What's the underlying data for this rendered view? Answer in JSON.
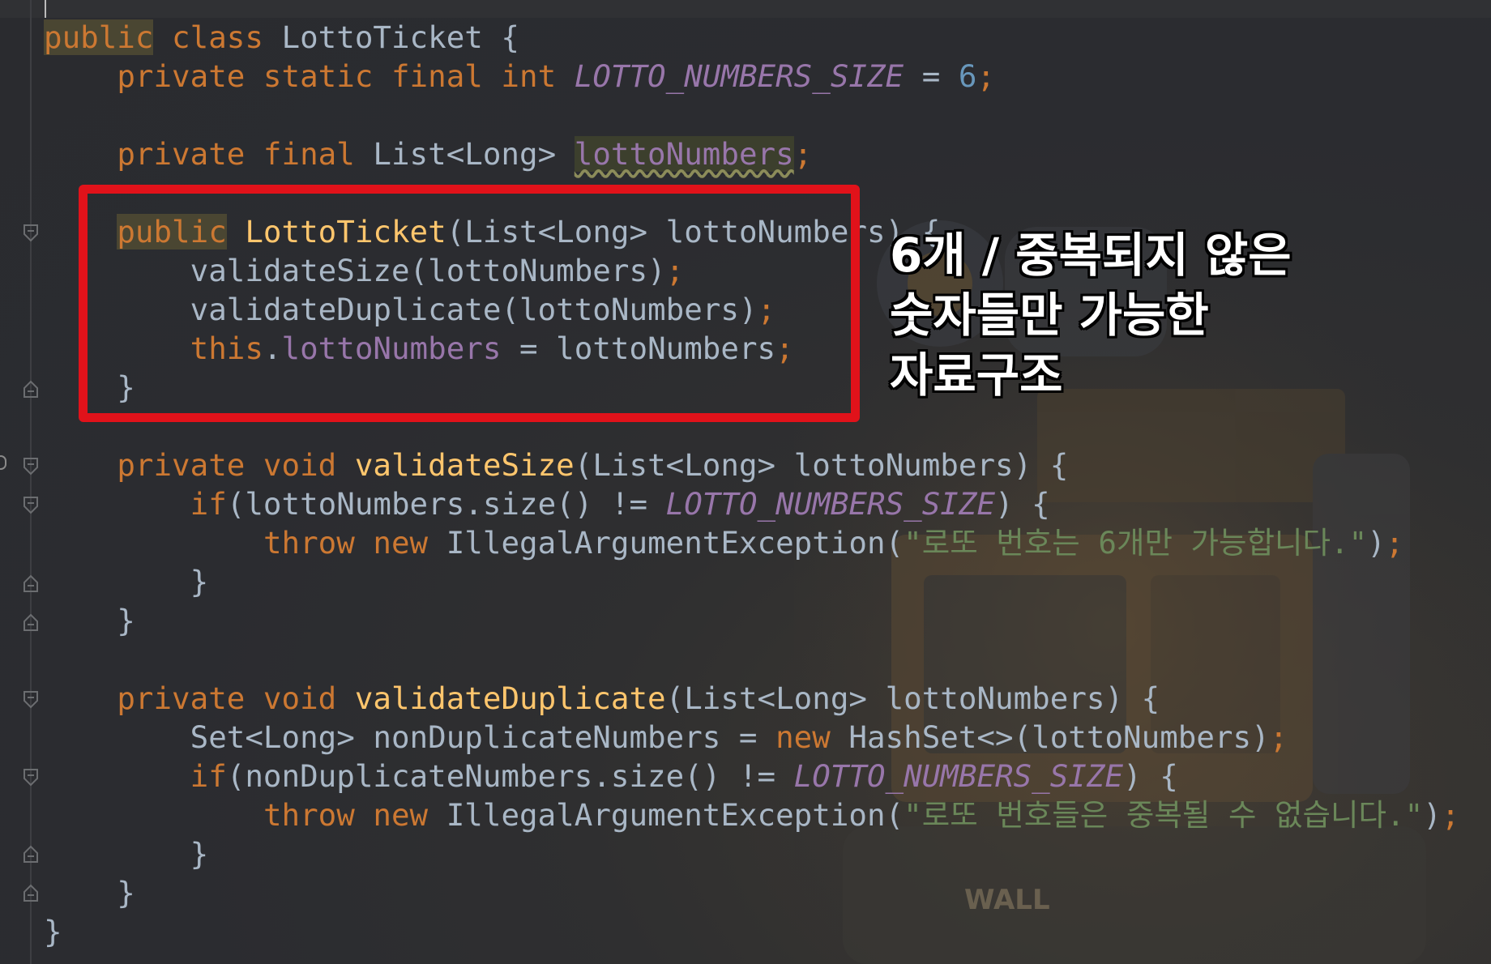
{
  "editor": {
    "lines": [
      [
        {
          "t": "public",
          "c": "kw hl"
        },
        {
          "t": " "
        },
        {
          "t": "class",
          "c": "kw"
        },
        {
          "t": " LottoTicket {"
        }
      ],
      [
        {
          "t": "    "
        },
        {
          "t": "private static final int",
          "c": "kw"
        },
        {
          "t": " "
        },
        {
          "t": "LOTTO_NUMBERS_SIZE",
          "c": "cst"
        },
        {
          "t": " = "
        },
        {
          "t": "6",
          "c": "num"
        },
        {
          "t": ";",
          "c": "kw"
        }
      ],
      [],
      [
        {
          "t": "    "
        },
        {
          "t": "private final",
          "c": "kw"
        },
        {
          "t": " List<Long> "
        },
        {
          "t": "lottoNumbers",
          "c": "fld warn"
        },
        {
          "t": ";",
          "c": "kw"
        }
      ],
      [],
      [
        {
          "t": "    "
        },
        {
          "t": "public",
          "c": "kw hl"
        },
        {
          "t": " "
        },
        {
          "t": "LottoTicket",
          "c": "fn"
        },
        {
          "t": "(List<Long> lottoNumbers) {"
        }
      ],
      [
        {
          "t": "        validateSize(lottoNumbers)"
        },
        {
          "t": ";",
          "c": "kw"
        }
      ],
      [
        {
          "t": "        validateDuplicate(lottoNumbers)"
        },
        {
          "t": ";",
          "c": "kw"
        }
      ],
      [
        {
          "t": "        "
        },
        {
          "t": "this",
          "c": "kw"
        },
        {
          "t": "."
        },
        {
          "t": "lottoNumbers",
          "c": "fld"
        },
        {
          "t": " = lottoNumbers"
        },
        {
          "t": ";",
          "c": "kw"
        }
      ],
      [
        {
          "t": "    }"
        }
      ],
      [],
      [
        {
          "t": "    "
        },
        {
          "t": "private void",
          "c": "kw"
        },
        {
          "t": " "
        },
        {
          "t": "validateSize",
          "c": "fn"
        },
        {
          "t": "(List<Long> lottoNumbers) {"
        }
      ],
      [
        {
          "t": "        "
        },
        {
          "t": "if",
          "c": "kw"
        },
        {
          "t": "(lottoNumbers.size() != "
        },
        {
          "t": "LOTTO_NUMBERS_SIZE",
          "c": "cst"
        },
        {
          "t": ") {"
        }
      ],
      [
        {
          "t": "            "
        },
        {
          "t": "throw new",
          "c": "kw"
        },
        {
          "t": " IllegalArgumentException("
        },
        {
          "t": "\"로또 번호는 6개만 가능합니다.\"",
          "c": "str"
        },
        {
          "t": ")"
        },
        {
          "t": ";",
          "c": "kw"
        }
      ],
      [
        {
          "t": "        }"
        }
      ],
      [
        {
          "t": "    }"
        }
      ],
      [],
      [
        {
          "t": "    "
        },
        {
          "t": "private void",
          "c": "kw"
        },
        {
          "t": " "
        },
        {
          "t": "validateDuplicate",
          "c": "fn"
        },
        {
          "t": "(List<Long> lottoNumbers) {"
        }
      ],
      [
        {
          "t": "        Set<Long> nonDuplicateNumbers = "
        },
        {
          "t": "new",
          "c": "kw"
        },
        {
          "t": " HashSet<>(lottoNumbers)"
        },
        {
          "t": ";",
          "c": "kw"
        }
      ],
      [
        {
          "t": "        "
        },
        {
          "t": "if",
          "c": "kw"
        },
        {
          "t": "(nonDuplicateNumbers.size() != "
        },
        {
          "t": "LOTTO_NUMBERS_SIZE",
          "c": "cst"
        },
        {
          "t": ") {"
        }
      ],
      [
        {
          "t": "            "
        },
        {
          "t": "throw new",
          "c": "kw"
        },
        {
          "t": " IllegalArgumentException("
        },
        {
          "t": "\"로또 번호들은 중복될 수 없습니다.\"",
          "c": "str"
        },
        {
          "t": ")"
        },
        {
          "t": ";",
          "c": "kw"
        }
      ],
      [
        {
          "t": "        }"
        }
      ],
      [
        {
          "t": "    }"
        }
      ],
      [
        {
          "t": "}"
        }
      ]
    ]
  },
  "annotation": {
    "lines": [
      "6개 / 중복되지 않은",
      "숫자들만 가능한",
      "자료구조"
    ]
  },
  "background": {
    "logo_text": "WALL"
  },
  "colors": {
    "keyword": "#cc7832",
    "method": "#ffc66d",
    "constant": "#9876aa",
    "string": "#6a8759",
    "number": "#6897bb",
    "text": "#a9b7c6",
    "highlight_box": "#e1121a"
  }
}
